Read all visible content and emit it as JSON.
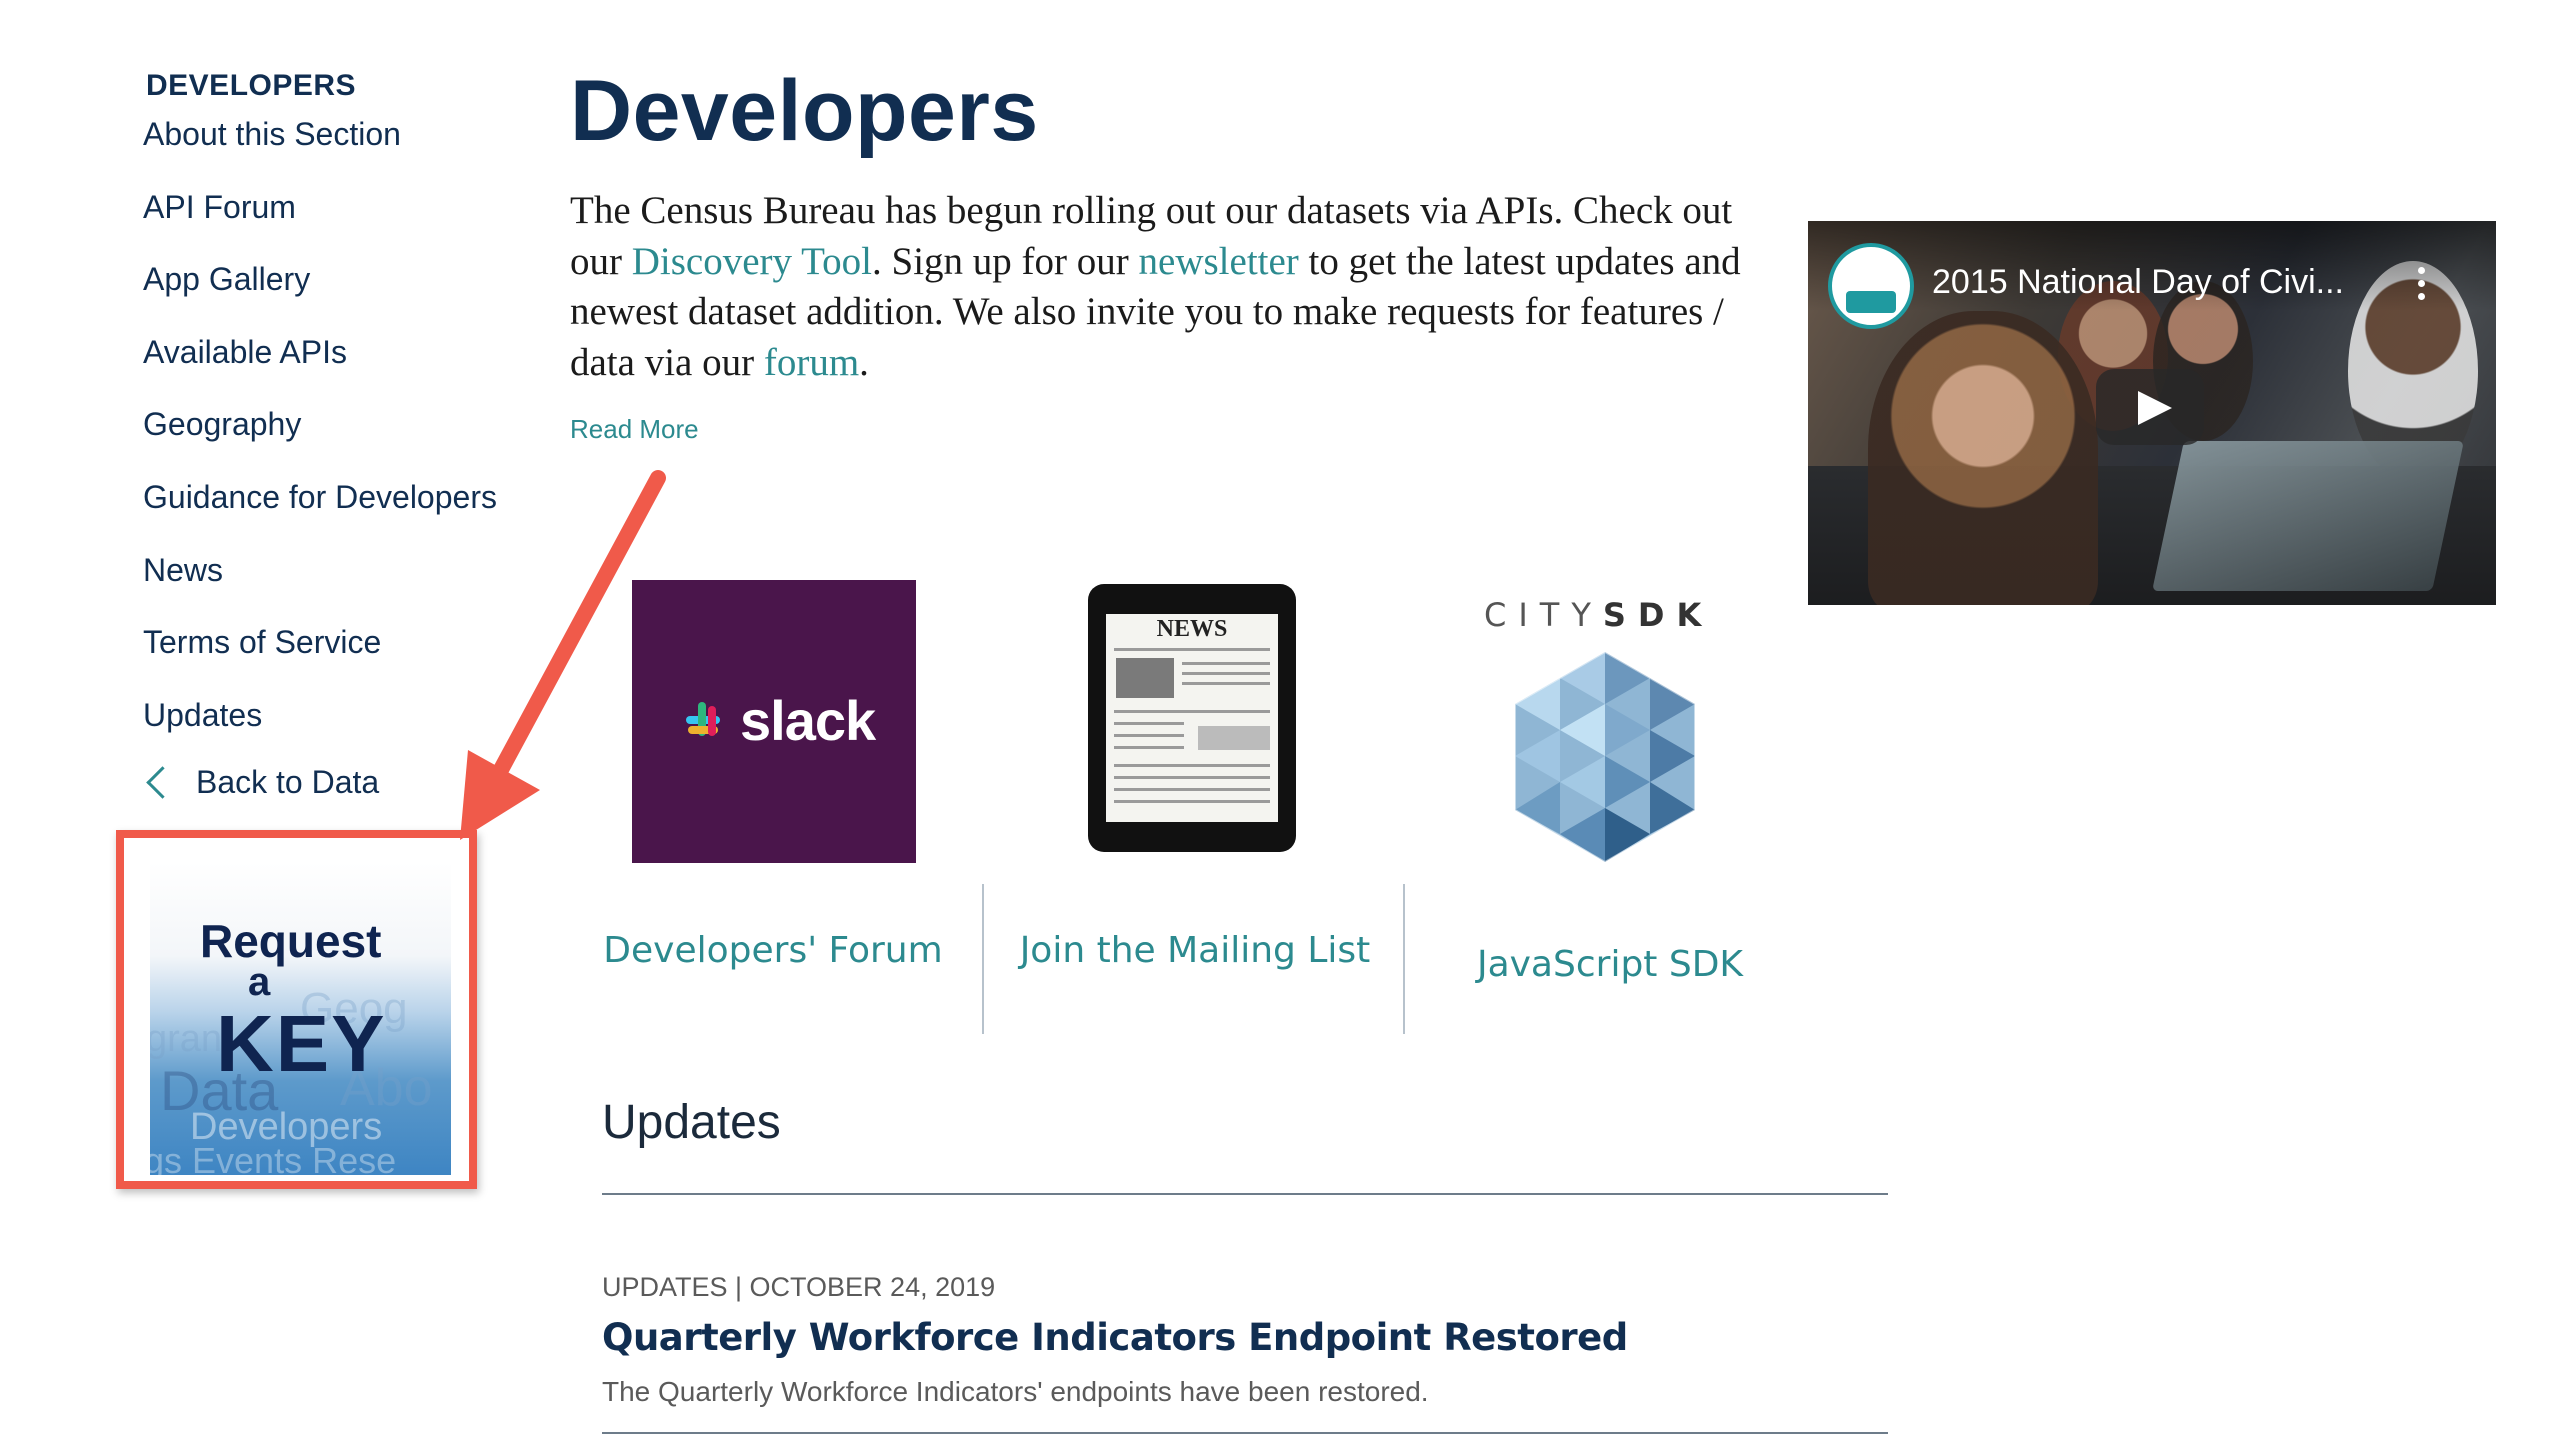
{
  "sidebar": {
    "heading": "DEVELOPERS",
    "items": [
      {
        "label": "About this Section"
      },
      {
        "label": "API Forum"
      },
      {
        "label": "App Gallery"
      },
      {
        "label": "Available APIs"
      },
      {
        "label": "Geography"
      },
      {
        "label": "Guidance for Developers"
      },
      {
        "label": "News"
      },
      {
        "label": "Terms of Service"
      },
      {
        "label": "Updates"
      }
    ],
    "back_label": "Back to Data",
    "key_image": {
      "line1": "Request",
      "line2": "a",
      "line3": "KEY",
      "watermark": [
        "Geog",
        "gran",
        "Data",
        "Abo",
        "Developers",
        "gs Events Rese"
      ]
    }
  },
  "main": {
    "title": "Developers",
    "intro": {
      "part1": "The Census Bureau has begun rolling out our datasets via APIs.  Check out our ",
      "link1": "Discovery Tool",
      "part2": ". Sign up for our ",
      "link2": "newsletter",
      "part3": " to get the latest updates and newest dataset addition. We also invite you to make requests for features / data via our ",
      "link3": "forum",
      "part4": "."
    },
    "read_more": "Read More",
    "video": {
      "title": "2015 National Day of Civi..."
    },
    "cards": [
      {
        "label": "Developers' Forum",
        "image_text": "slack",
        "icon": "slack-logo-icon"
      },
      {
        "label": "Join the Mailing List",
        "image_text": "NEWS",
        "icon": "tablet-news-icon"
      },
      {
        "label": "JavaScript SDK",
        "image_text_light": "CITY",
        "image_text_bold": "SDK",
        "icon": "citysdk-hex-icon"
      }
    ]
  },
  "updates": {
    "heading": "Updates",
    "posts": [
      {
        "meta": "UPDATES | OCTOBER 24, 2019",
        "title": "Quarterly Workforce Indicators Endpoint Restored",
        "summary": "The Quarterly Workforce Indicators' endpoints have been restored."
      }
    ]
  },
  "colors": {
    "navy": "#112e51",
    "teal": "#2c8a8f",
    "annotation_red": "#f05a4a",
    "slack_purple": "#4a154b"
  }
}
